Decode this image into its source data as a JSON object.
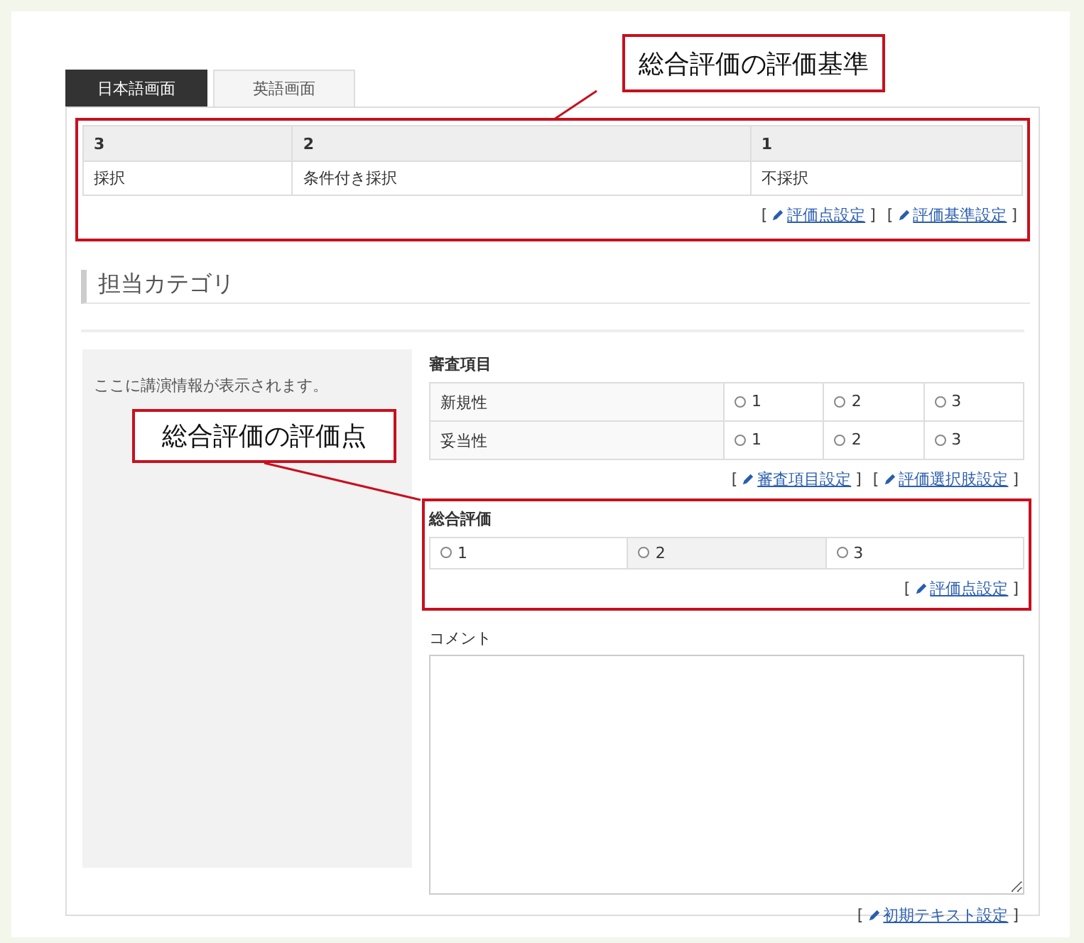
{
  "tabs": [
    {
      "label": "日本語画面",
      "selected": true
    },
    {
      "label": "英語画面",
      "selected": false
    }
  ],
  "criteria": {
    "columns": [
      "3",
      "2",
      "1"
    ],
    "row": [
      "採択",
      "条件付き採択",
      "不採択"
    ],
    "links": [
      {
        "open": "[",
        "label": "評価点設定",
        "close": "]"
      },
      {
        "open": "[",
        "label": "評価基準設定",
        "close": "]"
      }
    ]
  },
  "category": {
    "title": "担当カテゴリ"
  },
  "applicant_info": {
    "text": "ここに講演情報が表示されます。"
  },
  "review_items": {
    "title": "審査項目",
    "rows": [
      {
        "name": "新規性",
        "options": [
          {
            "label": "1",
            "selected": false
          },
          {
            "label": "2",
            "selected": false
          },
          {
            "label": "3",
            "selected": false
          }
        ]
      },
      {
        "name": "妥当性",
        "options": [
          {
            "label": "1",
            "selected": false
          },
          {
            "label": "2",
            "selected": false
          },
          {
            "label": "3",
            "selected": false
          }
        ]
      }
    ],
    "links": [
      {
        "open": "[",
        "label": "審査項目設定",
        "close": "]"
      },
      {
        "open": "[",
        "label": "評価選択肢設定",
        "close": "]"
      }
    ]
  },
  "overall": {
    "title": "総合評価",
    "options": [
      {
        "label": "1",
        "selected": false
      },
      {
        "label": "2",
        "selected": false
      },
      {
        "label": "3",
        "selected": false
      }
    ],
    "links": [
      {
        "open": "[",
        "label": "評価点設定",
        "close": "]"
      }
    ]
  },
  "comment": {
    "label": "コメント",
    "links": [
      {
        "open": "[",
        "label": "初期テキスト設定",
        "close": "]"
      }
    ]
  },
  "annotations": [
    {
      "text": "総合評価の評価基準"
    },
    {
      "text": "総合評価の評価点"
    }
  ]
}
